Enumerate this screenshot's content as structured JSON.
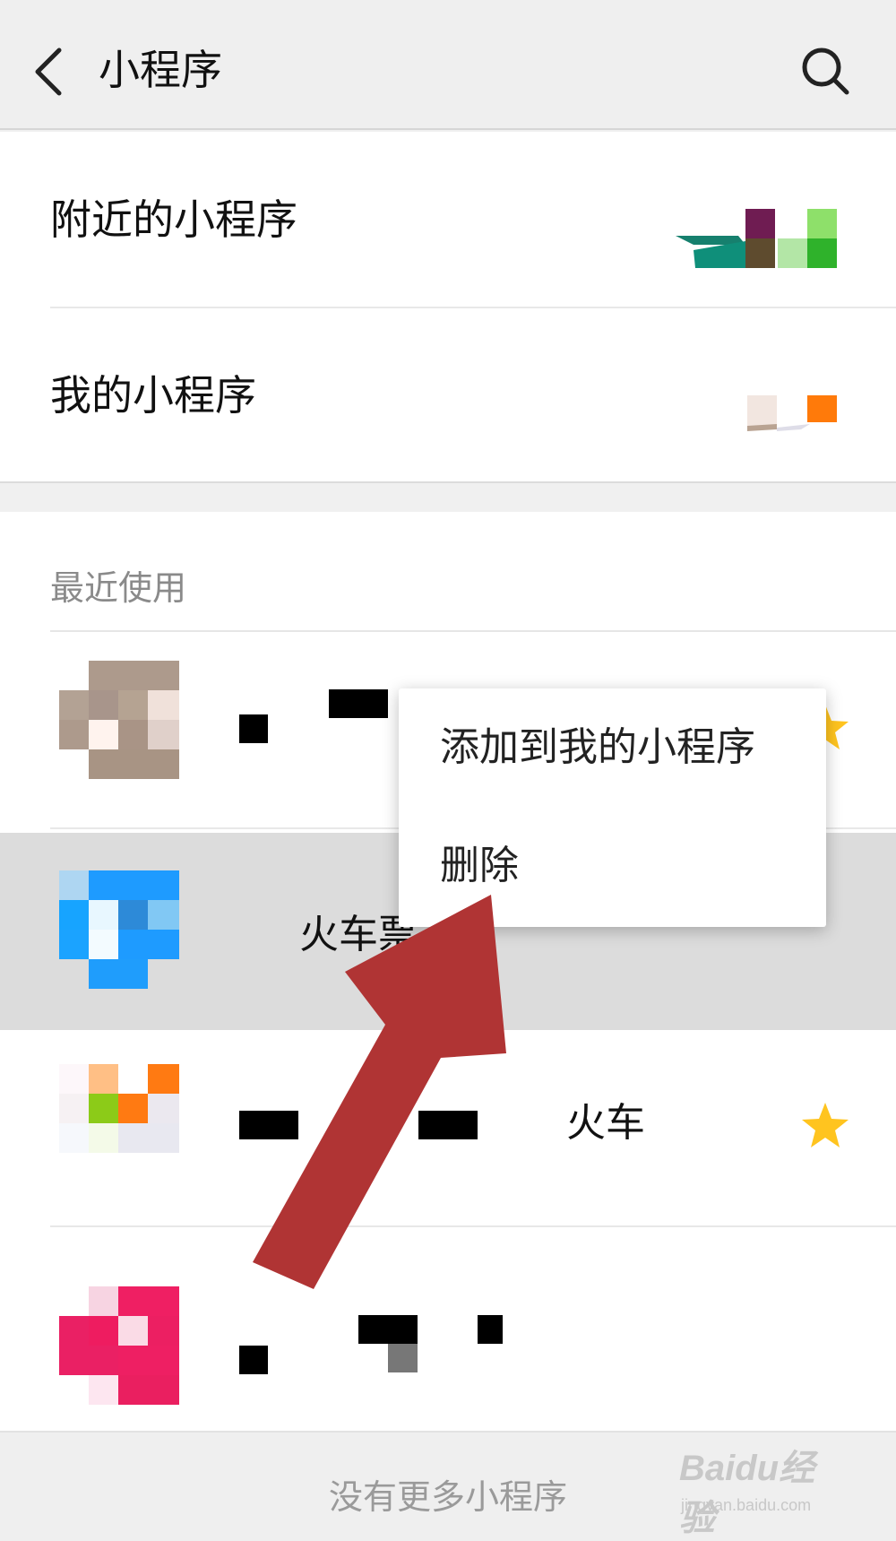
{
  "header": {
    "title": "小程序",
    "back_icon": "back-chevron-icon",
    "search_icon": "search-icon"
  },
  "entries": [
    {
      "label": "附近的小程序"
    },
    {
      "label": "我的小程序"
    }
  ],
  "recent": {
    "heading": "最近使用",
    "apps": [
      {
        "name": "",
        "starred": true,
        "state": "normal",
        "icon": "app-mosaic-icon"
      },
      {
        "name": "火车票",
        "starred": false,
        "state": "pressed",
        "icon": "app-mosaic-icon"
      },
      {
        "name": "火车",
        "starred": true,
        "state": "normal",
        "icon": "app-mosaic-icon"
      },
      {
        "name": "",
        "starred": false,
        "state": "normal",
        "icon": "app-mosaic-icon"
      }
    ]
  },
  "context_menu": {
    "items": [
      {
        "label": "添加到我的小程序"
      },
      {
        "label": "删除"
      }
    ]
  },
  "footer": {
    "text": "没有更多小程序"
  },
  "watermark": {
    "brand": "Baidu经验",
    "site": "jingyan.baidu.com"
  },
  "colors": {
    "star": "#ffc41f",
    "arrow": "#b03434",
    "pressed_row": "#dcdcdc"
  }
}
